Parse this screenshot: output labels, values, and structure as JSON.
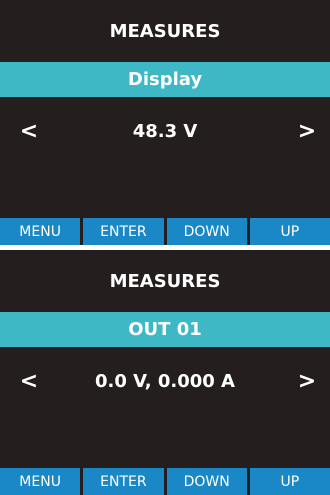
{
  "screens": [
    {
      "title": "MEASURES",
      "subtitle": "Display",
      "value": "48.3 V",
      "prev_glyph": "<",
      "next_glyph": ">",
      "softkeys": [
        "MENU",
        "ENTER",
        "DOWN",
        "UP"
      ]
    },
    {
      "title": "MEASURES",
      "subtitle": "OUT 01",
      "value": "0.0 V, 0.000 A",
      "prev_glyph": "<",
      "next_glyph": ">",
      "softkeys": [
        "MENU",
        "ENTER",
        "DOWN",
        "UP"
      ]
    }
  ],
  "colors": {
    "background": "#241e1e",
    "accent_bar": "#3fb8c5",
    "softkey": "#1a88c7",
    "text": "#ffffff"
  }
}
